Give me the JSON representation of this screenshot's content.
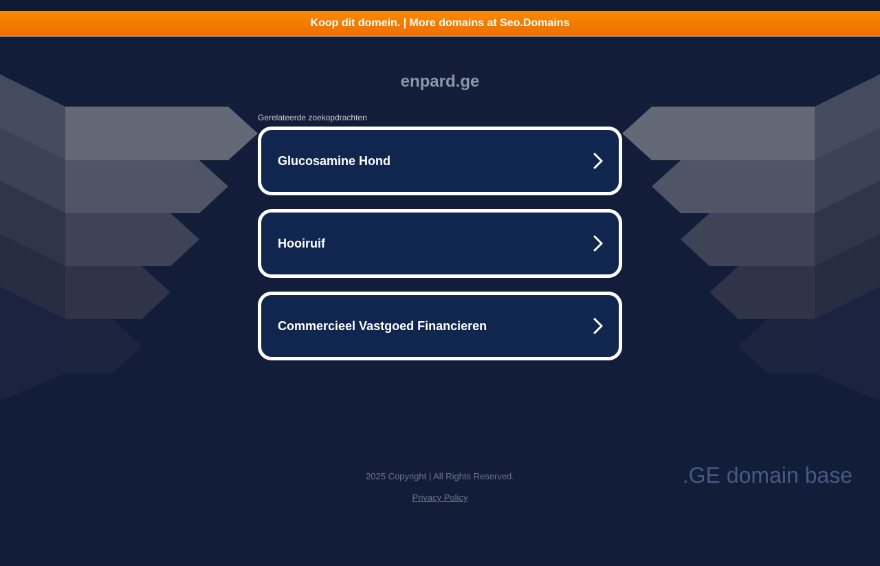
{
  "banner": {
    "text": "Koop dit domein. | More domains at Seo.Domains",
    "color": "#f57f00"
  },
  "domain": "enpard.ge",
  "related": {
    "label": "Gerelateerde zoekopdrachten",
    "items": [
      {
        "label": "Glucosamine Hond"
      },
      {
        "label": "Hooiruif"
      },
      {
        "label": "Commercieel Vastgoed Financieren"
      }
    ]
  },
  "footer": {
    "copyright": "2025 Copyright | All Rights Reserved.",
    "privacy": "Privacy Policy",
    "brand": ".GE domain base"
  },
  "colors": {
    "background": "#121d39",
    "card": "#10264f",
    "card_border": "#ffffff"
  }
}
